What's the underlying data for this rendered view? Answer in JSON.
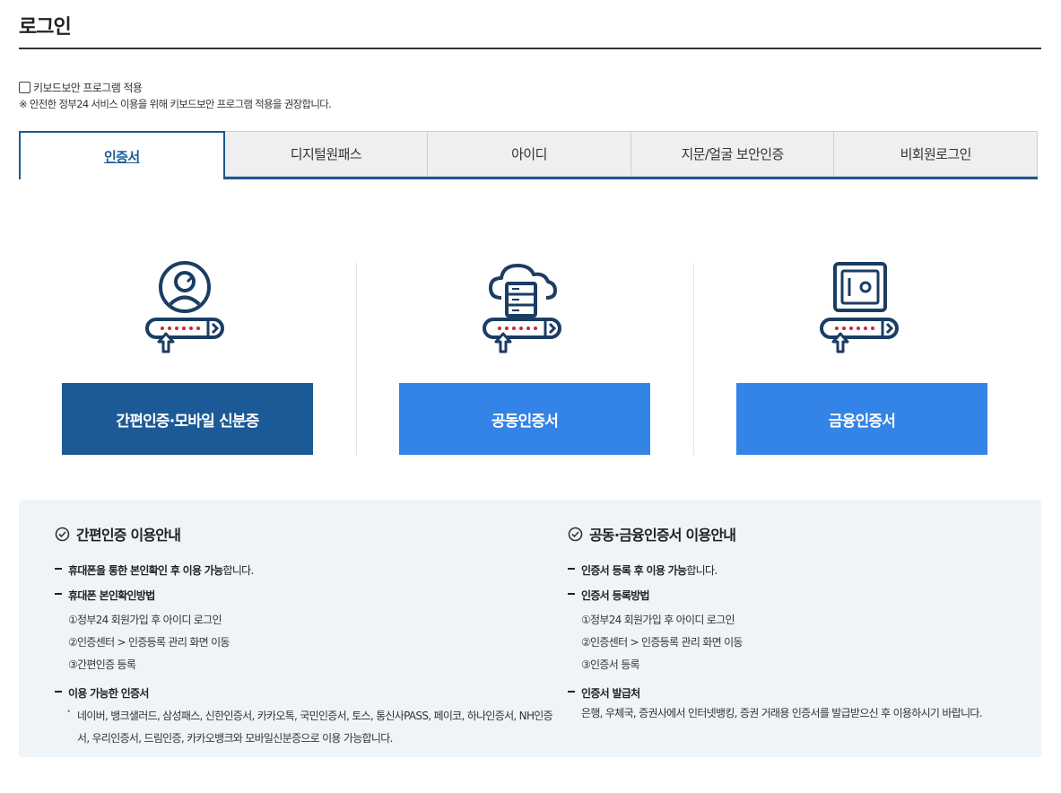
{
  "page_title": "로그인",
  "keyboard_security": {
    "label": "키보드보안 프로그램 적용",
    "checked": false,
    "note": "※ 안전한 정부24 서비스 이용을 위해 키보드보안 프로그램 적용을 권장합니다."
  },
  "tabs": [
    {
      "label": "인증서",
      "active": true
    },
    {
      "label": "디지털원패스",
      "active": false
    },
    {
      "label": "아이디",
      "active": false
    },
    {
      "label": "지문/얼굴 보안인증",
      "active": false
    },
    {
      "label": "비회원로그인",
      "active": false
    }
  ],
  "methods": [
    {
      "icon": "user-circle-icon",
      "label": "간편인증·모바일 신분증"
    },
    {
      "icon": "cloud-server-icon",
      "label": "공동인증서"
    },
    {
      "icon": "safe-icon",
      "label": "금융인증서"
    }
  ],
  "info": {
    "simple": {
      "title": "간편인증 이용안내",
      "item1_bold": "휴대폰을 통한 본인확인 후 이용 가능",
      "item1_rest": "합니다.",
      "item2_title": "휴대폰 본인확인방법",
      "steps": [
        "①정부24 회원가입 후 아이디 로그인",
        "②인증센터 > 인증등록 관리 화면 이동",
        "③간편인증 등록"
      ],
      "item3_title": "이용 가능한 인증서",
      "available": "네이버, 뱅크샐러드, 삼성패스, 신한인증서, 카카오톡, 국민인증서, 토스, 통신사PASS, 페이코, 하나인증서, NH인증서, 우리인증서, 드림인증, 카카오뱅크와 모바일신분증으로 이용 가능합니다."
    },
    "cert": {
      "title": "공동·금융인증서 이용안내",
      "item1_bold": "인증서 등록 후 이용 가능",
      "item1_rest": "합니다.",
      "item2_title": "인증서 등록방법",
      "steps": [
        "①정부24 회원가입 후 아이디 로그인",
        "②인증센터 > 인증등록 관리 화면 이동",
        "③인증서 등록"
      ],
      "item3_title": "인증서 발급처",
      "issuer": "은행, 우체국, 증권사에서 인터넷뱅킹, 증권 거래용 인증서를 발급받으신 후 이용하시기 바랍니다."
    }
  },
  "colors": {
    "primary": "#1b5a96",
    "bright": "#3384e6",
    "icon_navy": "#1b3d63",
    "icon_red": "#d0262e",
    "info_bg": "#eff4f8"
  }
}
